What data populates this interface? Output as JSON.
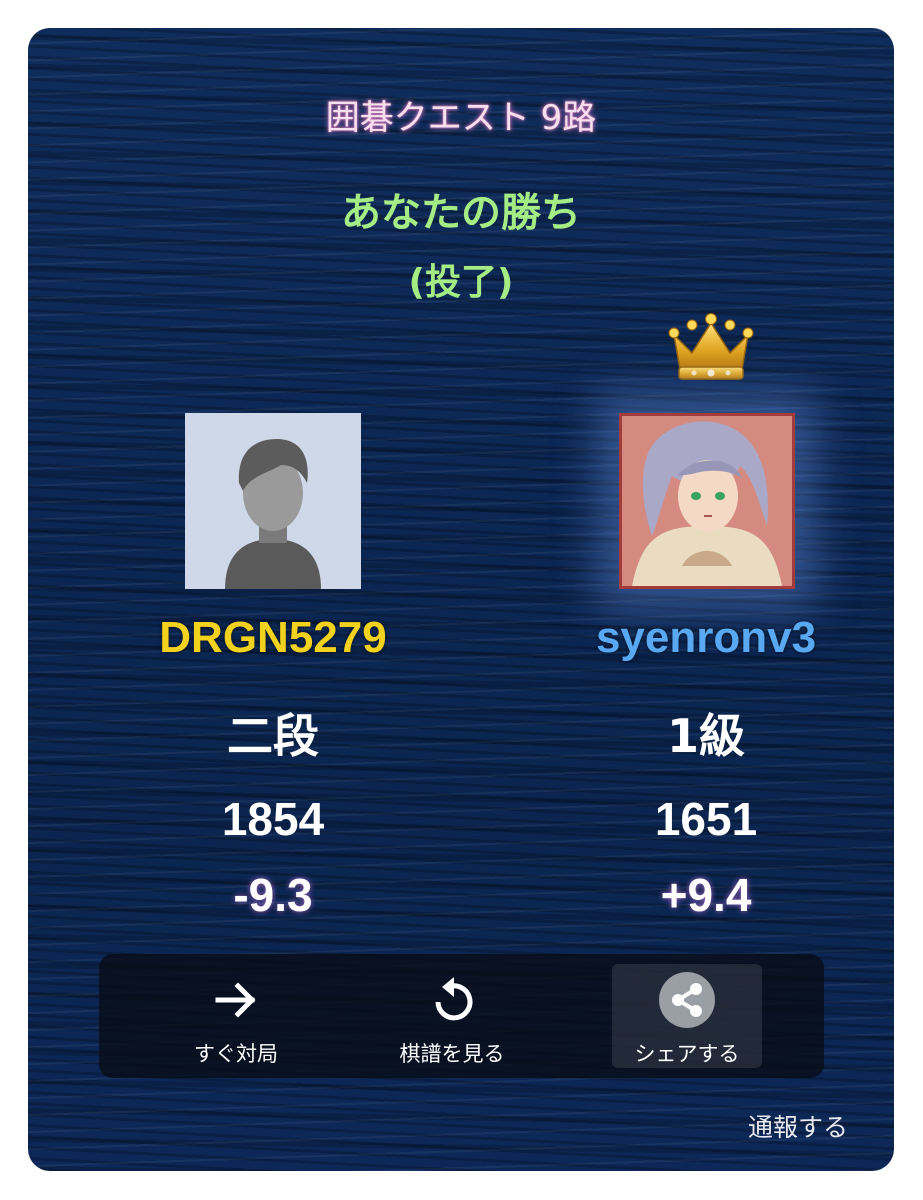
{
  "header": {
    "title": "囲碁クエスト 9路"
  },
  "result": {
    "main": "あなたの勝ち",
    "sub": "(投了)"
  },
  "players": [
    {
      "name": "DRGN5279",
      "rank": "二段",
      "rating": "1854",
      "delta": "-9.3",
      "name_color": "#f2d21c",
      "avatar": "default-user-avatar"
    },
    {
      "name": "syenronv3",
      "rank": "1級",
      "rating": "1651",
      "delta": "+9.4",
      "name_color": "#58a8f2",
      "avatar": "anime-character-avatar",
      "winner_badge": "crown-icon"
    }
  ],
  "actions": [
    {
      "label": "すぐ対局",
      "icon": "arrow-right-icon"
    },
    {
      "label": "棋譜を見る",
      "icon": "replay-icon"
    },
    {
      "label": "シェアする",
      "icon": "share-icon"
    }
  ],
  "footer": {
    "report_label": "通報する"
  },
  "colors": {
    "background": "#0c2754",
    "win_text": "#a6ec84",
    "title_glow": "#e678c8"
  }
}
